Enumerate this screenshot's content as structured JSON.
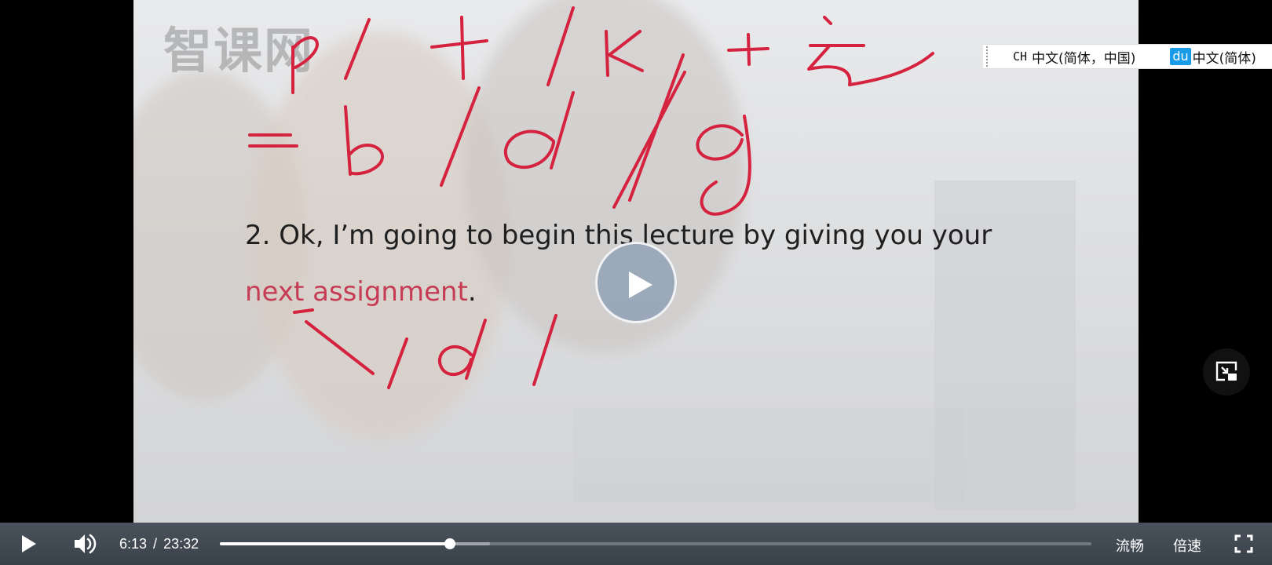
{
  "video": {
    "watermark": "智课网",
    "caption": {
      "line1": "2. Ok, I’m going to begin this lecture by giving you your",
      "line2_emphasis": "next assignment",
      "line2_tail": "."
    },
    "handwriting": {
      "top_line": "/p/ + /t/ /k/ + 元",
      "middle_line": "= /b/ /d/ /g/",
      "bottom_line": "/d/"
    }
  },
  "ime_bar": {
    "ch_label": "CH",
    "lang_label": "中文(简体，中国)",
    "badge": "du",
    "lang_label_2": "中文(简体)"
  },
  "controls": {
    "current_time": "6:13",
    "separator": "/",
    "duration": "23:32",
    "progress_fraction": 0.264,
    "buffered_fraction": 0.31,
    "quality_label": "流畅",
    "speed_label": "倍速"
  },
  "colors": {
    "ink": "#d4223f",
    "caption_emphasis": "#c63c55",
    "ime_badge": "#1a9be8"
  },
  "icons": {
    "center_play": "play-icon",
    "play": "play-icon",
    "volume": "volume-icon",
    "pip": "picture-in-picture-icon",
    "fullscreen": "fullscreen-icon",
    "ime_grip": "grip-icon"
  }
}
